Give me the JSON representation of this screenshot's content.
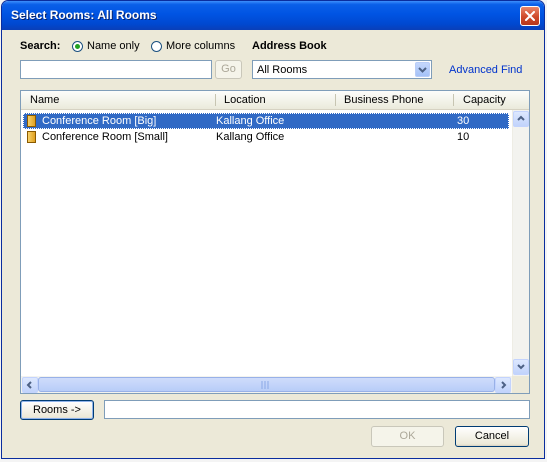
{
  "window": {
    "title": "Select Rooms: All Rooms"
  },
  "search": {
    "label": "Search:",
    "name_only": "Name only",
    "more_columns": "More columns",
    "selected": "Name only",
    "value": "",
    "go_label": "Go"
  },
  "address_book": {
    "label": "Address Book",
    "selected": "All Rooms",
    "advanced_find": "Advanced Find"
  },
  "list": {
    "columns": [
      "Name",
      "Location",
      "Business Phone",
      "Capacity"
    ],
    "rows": [
      {
        "name": "Conference Room [Big]",
        "location": "Kallang Office",
        "phone": "",
        "capacity": "30",
        "selected": true
      },
      {
        "name": "Conference Room [Small]",
        "location": "Kallang Office",
        "phone": "",
        "capacity": "10",
        "selected": false
      }
    ]
  },
  "footer": {
    "rooms_button": "Rooms ->",
    "rooms_value": "",
    "ok_label": "OK",
    "cancel_label": "Cancel"
  }
}
